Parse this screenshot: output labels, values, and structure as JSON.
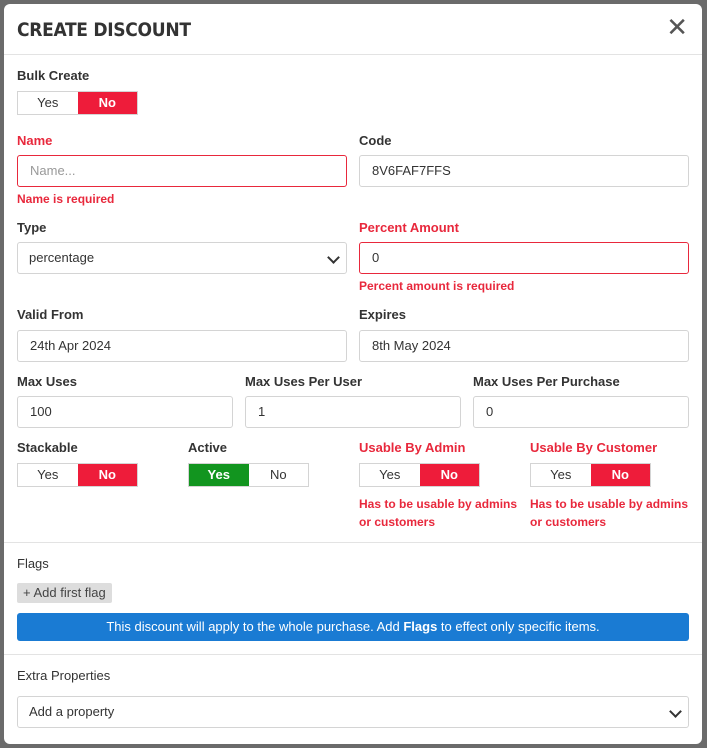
{
  "modal": {
    "title": "CREATE DISCOUNT",
    "close": "✕"
  },
  "bulk_create": {
    "label": "Bulk Create",
    "yes": "Yes",
    "no": "No",
    "selected": "No"
  },
  "name": {
    "label": "Name",
    "placeholder": "Name...",
    "value": "",
    "error": "Name is required"
  },
  "code": {
    "label": "Code",
    "value": "8V6FAF7FFS"
  },
  "type": {
    "label": "Type",
    "value": "percentage"
  },
  "percent_amount": {
    "label": "Percent Amount",
    "value": "0",
    "error": "Percent amount is required"
  },
  "valid_from": {
    "label": "Valid From",
    "value": "24th Apr 2024"
  },
  "expires": {
    "label": "Expires",
    "value": "8th May 2024"
  },
  "max_uses": {
    "label": "Max Uses",
    "value": "100"
  },
  "max_uses_per_user": {
    "label": "Max Uses Per User",
    "value": "1"
  },
  "max_uses_per_purchase": {
    "label": "Max Uses Per Purchase",
    "value": "0"
  },
  "stackable": {
    "label": "Stackable",
    "yes": "Yes",
    "no": "No",
    "selected": "No"
  },
  "active": {
    "label": "Active",
    "yes": "Yes",
    "no": "No",
    "selected": "Yes"
  },
  "usable_by_admin": {
    "label": "Usable By Admin",
    "yes": "Yes",
    "no": "No",
    "selected": "No",
    "error_line1": "Has to be usable by admins",
    "error_line2": "or customers"
  },
  "usable_by_customer": {
    "label": "Usable By Customer",
    "yes": "Yes",
    "no": "No",
    "selected": "No",
    "error_line1": "Has to be usable by admins",
    "error_line2": "or customers"
  },
  "flags": {
    "label": "Flags",
    "add_icon": "+",
    "add_label": "Add first flag",
    "banner_pre": "This discount will apply to the whole purchase. Add ",
    "banner_bold": "Flags",
    "banner_post": " to effect only specific items."
  },
  "extra_properties": {
    "label": "Extra Properties",
    "select_value": "Add a property"
  },
  "colors": {
    "error": "#e8283c",
    "toggle_red": "#ee1c3a",
    "toggle_green": "#12951f",
    "banner": "#1a7bd3"
  }
}
